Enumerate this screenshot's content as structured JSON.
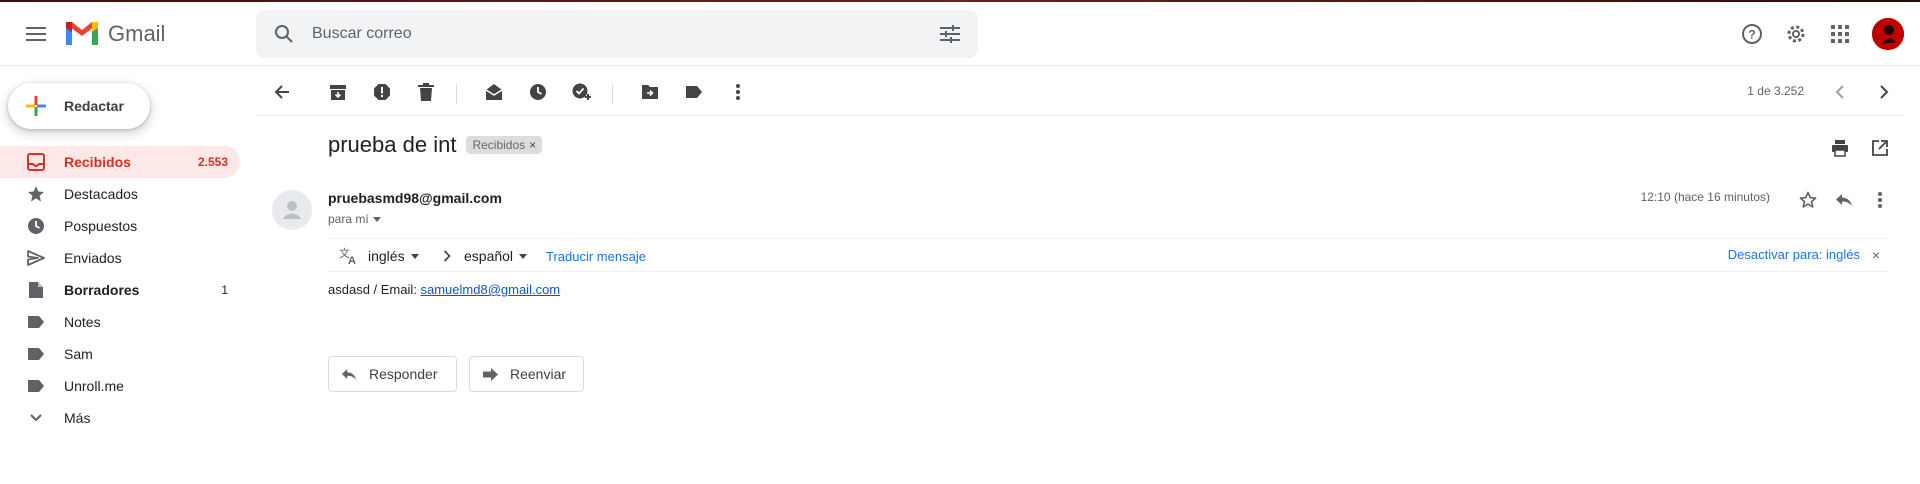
{
  "app": {
    "name": "Gmail"
  },
  "search": {
    "placeholder": "Buscar correo"
  },
  "compose": {
    "label": "Redactar"
  },
  "sidebar": {
    "items": [
      {
        "label": "Recibidos",
        "count": "2.553",
        "icon": "inbox-icon"
      },
      {
        "label": "Destacados",
        "count": "",
        "icon": "star-icon"
      },
      {
        "label": "Pospuestos",
        "count": "",
        "icon": "clock-icon"
      },
      {
        "label": "Enviados",
        "count": "",
        "icon": "send-icon"
      },
      {
        "label": "Borradores",
        "count": "1",
        "icon": "draft-icon"
      },
      {
        "label": "Notes",
        "count": "",
        "icon": "label-icon"
      },
      {
        "label": "Sam",
        "count": "",
        "icon": "label-icon"
      },
      {
        "label": "Unroll.me",
        "count": "",
        "icon": "label-icon"
      },
      {
        "label": "Más",
        "count": "",
        "icon": "chevron-down-icon"
      }
    ]
  },
  "toolbar": {
    "pager": "1 de 3.252"
  },
  "message": {
    "subject": "prueba de int",
    "label_chip": "Recibidos",
    "sender": "pruebasmd98@gmail.com",
    "to": "para mí",
    "time": "12:10 (hace 16 minutos)",
    "body_prefix": "asdasd / Email: ",
    "body_email": "samuelmd8@gmail.com"
  },
  "translate": {
    "from": "inglés",
    "to": "español",
    "link": "Traducir mensaje",
    "off": "Desactivar para: inglés"
  },
  "actions": {
    "reply": "Responder",
    "forward": "Reenviar"
  },
  "colors": {
    "accent": "#d93025",
    "active_bg": "#fce8e6",
    "link": "#1a73e8"
  }
}
